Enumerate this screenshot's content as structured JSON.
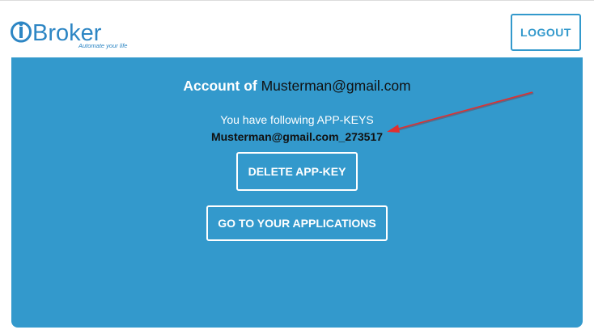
{
  "header": {
    "logo": {
      "brand_prefix": "i",
      "brand_name": "Broker",
      "tagline": "Automate your life"
    },
    "logout_label": "LOGOUT"
  },
  "account": {
    "heading_prefix": "Account of ",
    "email": "Musterman@gmail.com",
    "keys_label": "You have following APP-KEYS",
    "app_key": "Musterman@gmail.com_273517",
    "delete_button_label": "DELETE APP-KEY",
    "applications_button_label": "GO TO YOUR APPLICATIONS"
  },
  "colors": {
    "accent": "#3399cc",
    "annotation_arrow": "#e03030"
  },
  "icons": {
    "logo": "iobroker-logo",
    "annotation": "red-arrow-annotation"
  }
}
